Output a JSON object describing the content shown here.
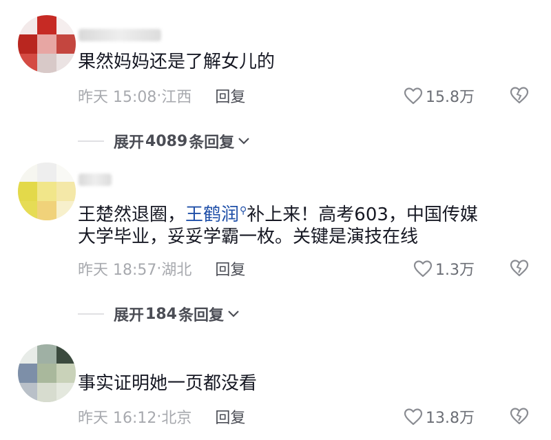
{
  "comments": [
    {
      "text": "果然妈妈还是了解女儿的",
      "date": "昨天 15:08",
      "location": "江西",
      "reply_label": "回复",
      "likes": "15.8万",
      "expand": {
        "prefix": "展开",
        "count": "4089",
        "suffix": "条回复"
      }
    },
    {
      "text_before": "王楚然退圈，",
      "mention": "王鹤润",
      "text_after": "补上来！高考603，中国传媒",
      "text_line2": "大学毕业，妥妥学霸一枚。关键是演技在线",
      "date": "昨天 18:57",
      "location": "湖北",
      "reply_label": "回复",
      "likes": "1.3万",
      "expand": {
        "prefix": "展开",
        "count": "184",
        "suffix": "条回复"
      }
    },
    {
      "text": "事实证明她一页都没看",
      "date": "昨天 16:12",
      "location": "北京",
      "reply_label": "回复",
      "likes": "13.8万"
    }
  ],
  "icons": {
    "like": "heart-outline-icon",
    "dislike": "broken-heart-icon",
    "expand": "chevron-down-icon",
    "mention": "search-icon"
  },
  "colors": {
    "text": "#161823",
    "meta": "#a7a9ae",
    "mention": "#1f4fa8"
  }
}
